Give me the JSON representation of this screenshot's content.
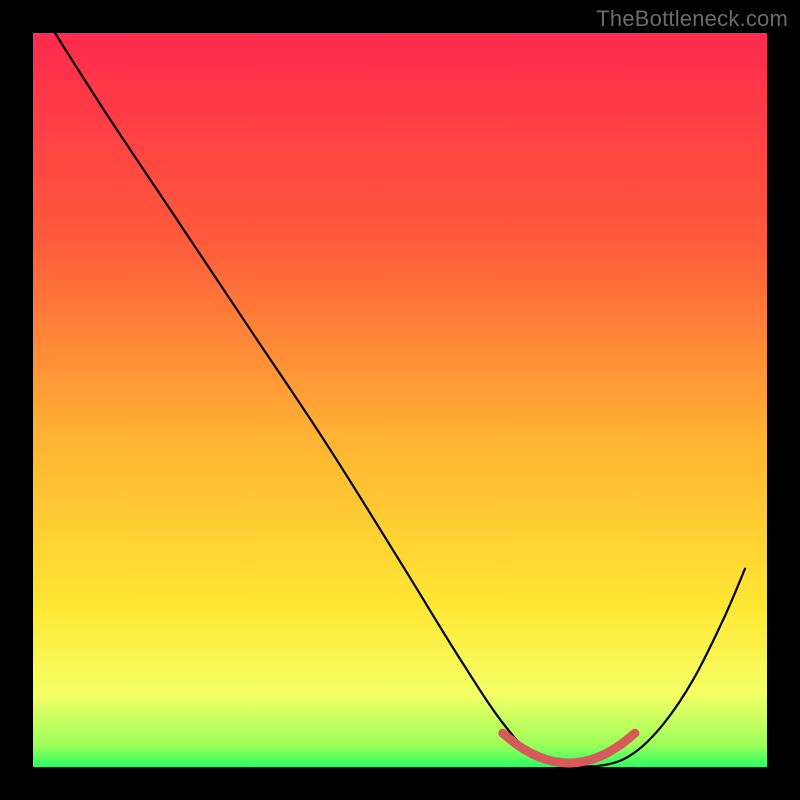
{
  "watermark": "TheBottleneck.com",
  "chart_data": {
    "type": "line",
    "title": "",
    "xlabel": "",
    "ylabel": "",
    "xlim": [
      0,
      100
    ],
    "ylim": [
      0,
      100
    ],
    "gradient_stops": [
      {
        "offset": 0,
        "color": "#ff2a4d"
      },
      {
        "offset": 28,
        "color": "#ff5a3c"
      },
      {
        "offset": 55,
        "color": "#ffb233"
      },
      {
        "offset": 78,
        "color": "#ffe733"
      },
      {
        "offset": 90,
        "color": "#f4ff66"
      },
      {
        "offset": 97,
        "color": "#9cff5a"
      },
      {
        "offset": 100,
        "color": "#2bff63"
      }
    ],
    "series": [
      {
        "name": "bottleneck-curve",
        "color": "#000000",
        "width": 2.2,
        "x": [
          3,
          10,
          20,
          30,
          40,
          50,
          58,
          64,
          68,
          73,
          78,
          82,
          86,
          90,
          94,
          97
        ],
        "y": [
          100,
          89,
          74,
          59,
          44,
          28,
          15,
          6,
          2,
          0.3,
          0.3,
          2,
          6,
          12,
          20,
          27
        ]
      },
      {
        "name": "optimal-band",
        "color": "#d65a5a",
        "width": 9,
        "x": [
          64,
          66,
          68,
          70,
          72,
          74,
          76,
          78,
          80,
          82
        ],
        "y": [
          4.6,
          3.0,
          1.8,
          1.0,
          0.6,
          0.6,
          1.0,
          1.8,
          3.0,
          4.6
        ]
      }
    ]
  }
}
